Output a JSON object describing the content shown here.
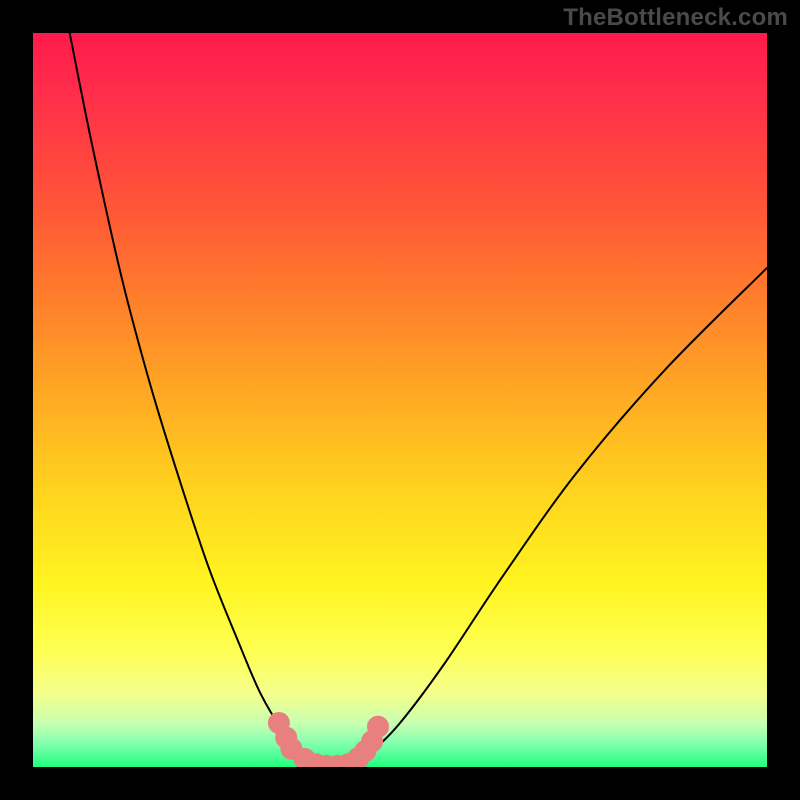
{
  "watermark": "TheBottleneck.com",
  "chart_data": {
    "type": "line",
    "title": "",
    "xlabel": "",
    "ylabel": "",
    "xlim": [
      0,
      100
    ],
    "ylim": [
      0,
      100
    ],
    "grid": false,
    "legend": false,
    "series": [
      {
        "name": "left-curve",
        "x": [
          5,
          8,
          12,
          16,
          20,
          24,
          28,
          31,
          34,
          37,
          38.5
        ],
        "y": [
          100,
          85,
          67,
          52,
          39,
          27,
          17,
          10,
          5,
          1.5,
          0
        ]
      },
      {
        "name": "right-curve",
        "x": [
          43,
          46,
          50,
          56,
          64,
          74,
          86,
          100
        ],
        "y": [
          0,
          2,
          6,
          14,
          26,
          40,
          54,
          68
        ]
      },
      {
        "name": "bottom-plateau",
        "x": [
          38.5,
          40.5,
          43
        ],
        "y": [
          0,
          0,
          0
        ]
      }
    ],
    "markers": {
      "name": "highlight-dots",
      "color": "#e98080",
      "points": [
        {
          "x": 33.5,
          "y": 6
        },
        {
          "x": 34.5,
          "y": 4
        },
        {
          "x": 35.2,
          "y": 2.5
        },
        {
          "x": 37,
          "y": 1.1
        },
        {
          "x": 38.5,
          "y": 0.4
        },
        {
          "x": 40,
          "y": 0.15
        },
        {
          "x": 41.5,
          "y": 0.15
        },
        {
          "x": 43,
          "y": 0.4
        },
        {
          "x": 44.3,
          "y": 1.2
        },
        {
          "x": 45.3,
          "y": 2.2
        },
        {
          "x": 46.2,
          "y": 3.5
        },
        {
          "x": 47,
          "y": 5.5
        }
      ]
    },
    "gradient_stops": [
      {
        "pos": 0,
        "color": "#ff1a4d"
      },
      {
        "pos": 22,
        "color": "#ff5138"
      },
      {
        "pos": 48,
        "color": "#ffa524"
      },
      {
        "pos": 75,
        "color": "#fff420"
      },
      {
        "pos": 94,
        "color": "#c8ffb0"
      },
      {
        "pos": 100,
        "color": "#1fff7c"
      }
    ]
  }
}
